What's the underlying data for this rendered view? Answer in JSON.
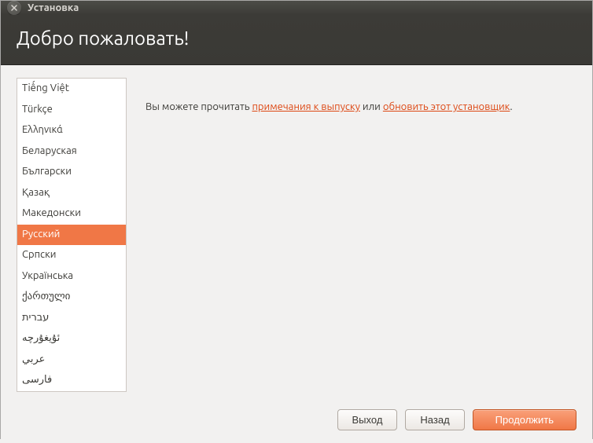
{
  "titlebar": {
    "title": "Установка"
  },
  "header": {
    "title": "Добро пожаловать!"
  },
  "languages": [
    {
      "label": "Tiếng Việt",
      "selected": false
    },
    {
      "label": "Türkçe",
      "selected": false
    },
    {
      "label": "Ελληνικά",
      "selected": false
    },
    {
      "label": "Беларуская",
      "selected": false
    },
    {
      "label": "Български",
      "selected": false
    },
    {
      "label": "Қазақ",
      "selected": false
    },
    {
      "label": "Македонски",
      "selected": false
    },
    {
      "label": "Русский",
      "selected": true
    },
    {
      "label": "Српски",
      "selected": false
    },
    {
      "label": "Українська",
      "selected": false
    },
    {
      "label": "ქართული",
      "selected": false
    },
    {
      "label": "עברית",
      "selected": false
    },
    {
      "label": "ئۇيغۇرچە",
      "selected": false
    },
    {
      "label": "عربي",
      "selected": false
    },
    {
      "label": "فارسی",
      "selected": false
    }
  ],
  "main": {
    "text_before": "Вы можете прочитать ",
    "link1": "примечания к выпуску",
    "text_middle": " или ",
    "link2": "обновить этот установщик",
    "text_after": "."
  },
  "footer": {
    "quit": "Выход",
    "back": "Назад",
    "continue": "Продолжить"
  }
}
